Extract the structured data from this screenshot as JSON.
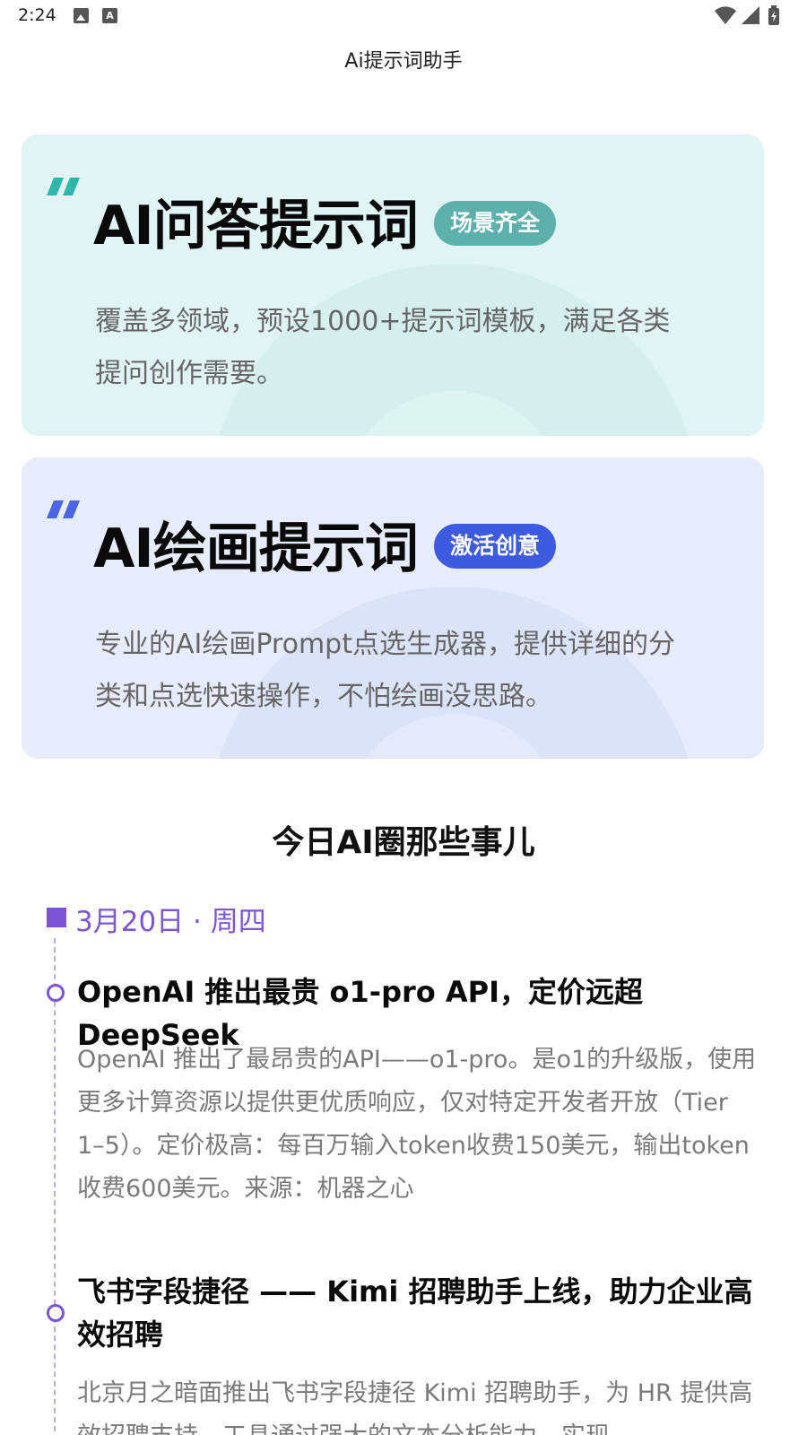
{
  "status_bar": {
    "time": "2:24",
    "a_label": "A"
  },
  "app": {
    "title": "Ai提示词助手"
  },
  "cards": [
    {
      "title": "AI问答提示词",
      "badge": "场景齐全",
      "description": "覆盖多领域，预设1000+提示词模板，满足各类提问创作需要。",
      "accent": "#5db0ab",
      "background": "#e0f5f3"
    },
    {
      "title": "AI绘画提示词",
      "badge": "激活创意",
      "description": "专业的AI绘画Prompt点选生成器，提供详细的分类和点选快速操作，不怕绘画没思路。",
      "accent": "#3d5ae0",
      "background": "#e6ecfb"
    }
  ],
  "news": {
    "section_title": "今日AI圈那些事儿",
    "date": "3月20日 · 周四",
    "accent": "#7b55d6",
    "items": [
      {
        "title": "OpenAI 推出最贵 o1-pro API，定价远超 DeepSeek",
        "summary": "OpenAI 推出了最昂贵的API——o1-pro。是o1的升级版，使用更多计算资源以提供更优质响应，仅对特定开发者开放（Tier 1–5）。定价极高：每百万输入token收费150美元，输出token收费600美元。来源：机器之心"
      },
      {
        "title": "飞书字段捷径 —— Kimi 招聘助手上线，助力企业高效招聘",
        "summary": "北京月之暗面推出飞书字段捷径 Kimi 招聘助手，为 HR 提供高效招聘支持，工具通过强大的文本分析能力，实现"
      }
    ]
  }
}
